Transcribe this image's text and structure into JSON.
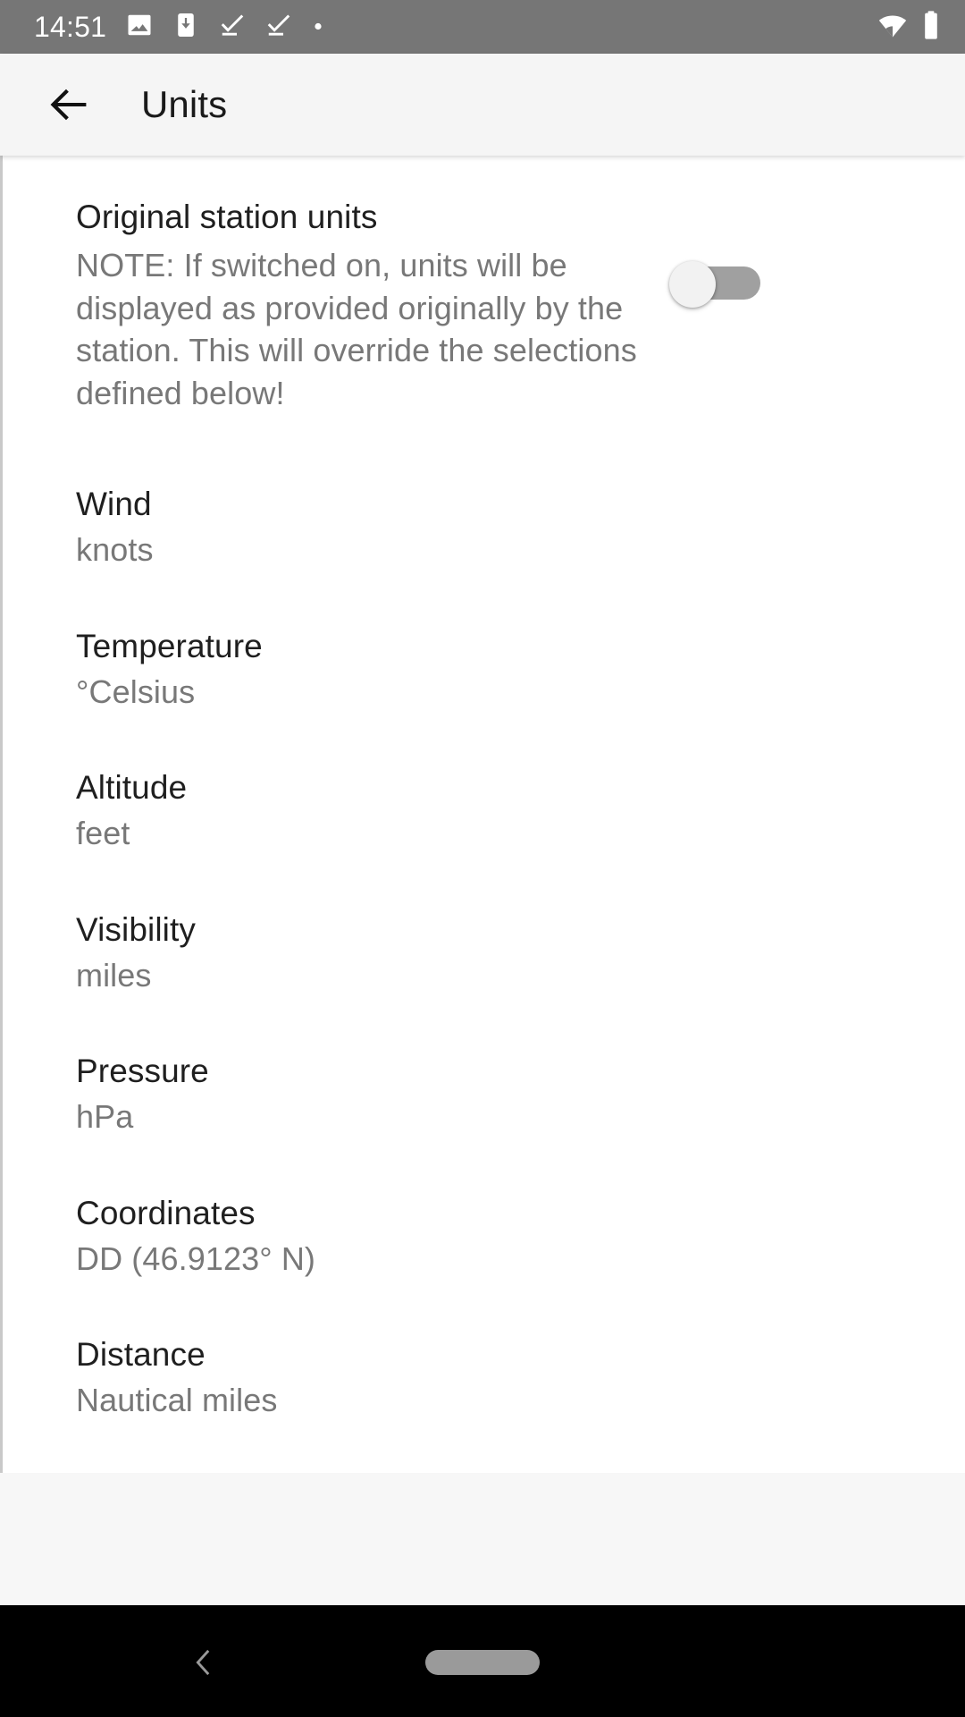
{
  "status_bar": {
    "time": "14:51",
    "left_icons": [
      {
        "name": "image-icon",
        "label": "image"
      },
      {
        "name": "download-to-device-icon",
        "label": "download"
      },
      {
        "name": "check-underline-icon-1",
        "label": "check"
      },
      {
        "name": "check-underline-icon-2",
        "label": "check"
      },
      {
        "name": "dot-icon",
        "label": "dot"
      }
    ],
    "right_icons": [
      {
        "name": "wifi-icon",
        "label": "wifi"
      },
      {
        "name": "battery-icon",
        "label": "battery"
      }
    ],
    "background": "#767676",
    "foreground": "#ffffff"
  },
  "app_bar": {
    "back_label": "Back",
    "title": "Units",
    "background": "#f5f5f5"
  },
  "preferences": {
    "switch_pref": {
      "title": "Original station units",
      "summary": "NOTE: If switched on, units will be displayed as provided originally by the station. This will override the selections defined below!",
      "checked": false,
      "state_label": "off",
      "track_color": "#a0a0a0",
      "thumb_color": "#f2f2f2"
    },
    "items": [
      {
        "title": "Wind",
        "summary": "knots"
      },
      {
        "title": "Temperature",
        "summary": "°Celsius"
      },
      {
        "title": "Altitude",
        "summary": "feet"
      },
      {
        "title": "Visibility",
        "summary": "miles"
      },
      {
        "title": "Pressure",
        "summary": "hPa"
      },
      {
        "title": "Coordinates",
        "summary": "DD (46.9123° N)"
      },
      {
        "title": "Distance",
        "summary": "Nautical miles"
      }
    ]
  },
  "nav_bar": {
    "back_label": "Back",
    "home_label": "Home",
    "background": "#000000"
  },
  "colors": {
    "title_text": "#1f1f1f",
    "summary_text": "#787878",
    "page_background": "#ffffff",
    "footer_background": "#f7f7f7"
  }
}
